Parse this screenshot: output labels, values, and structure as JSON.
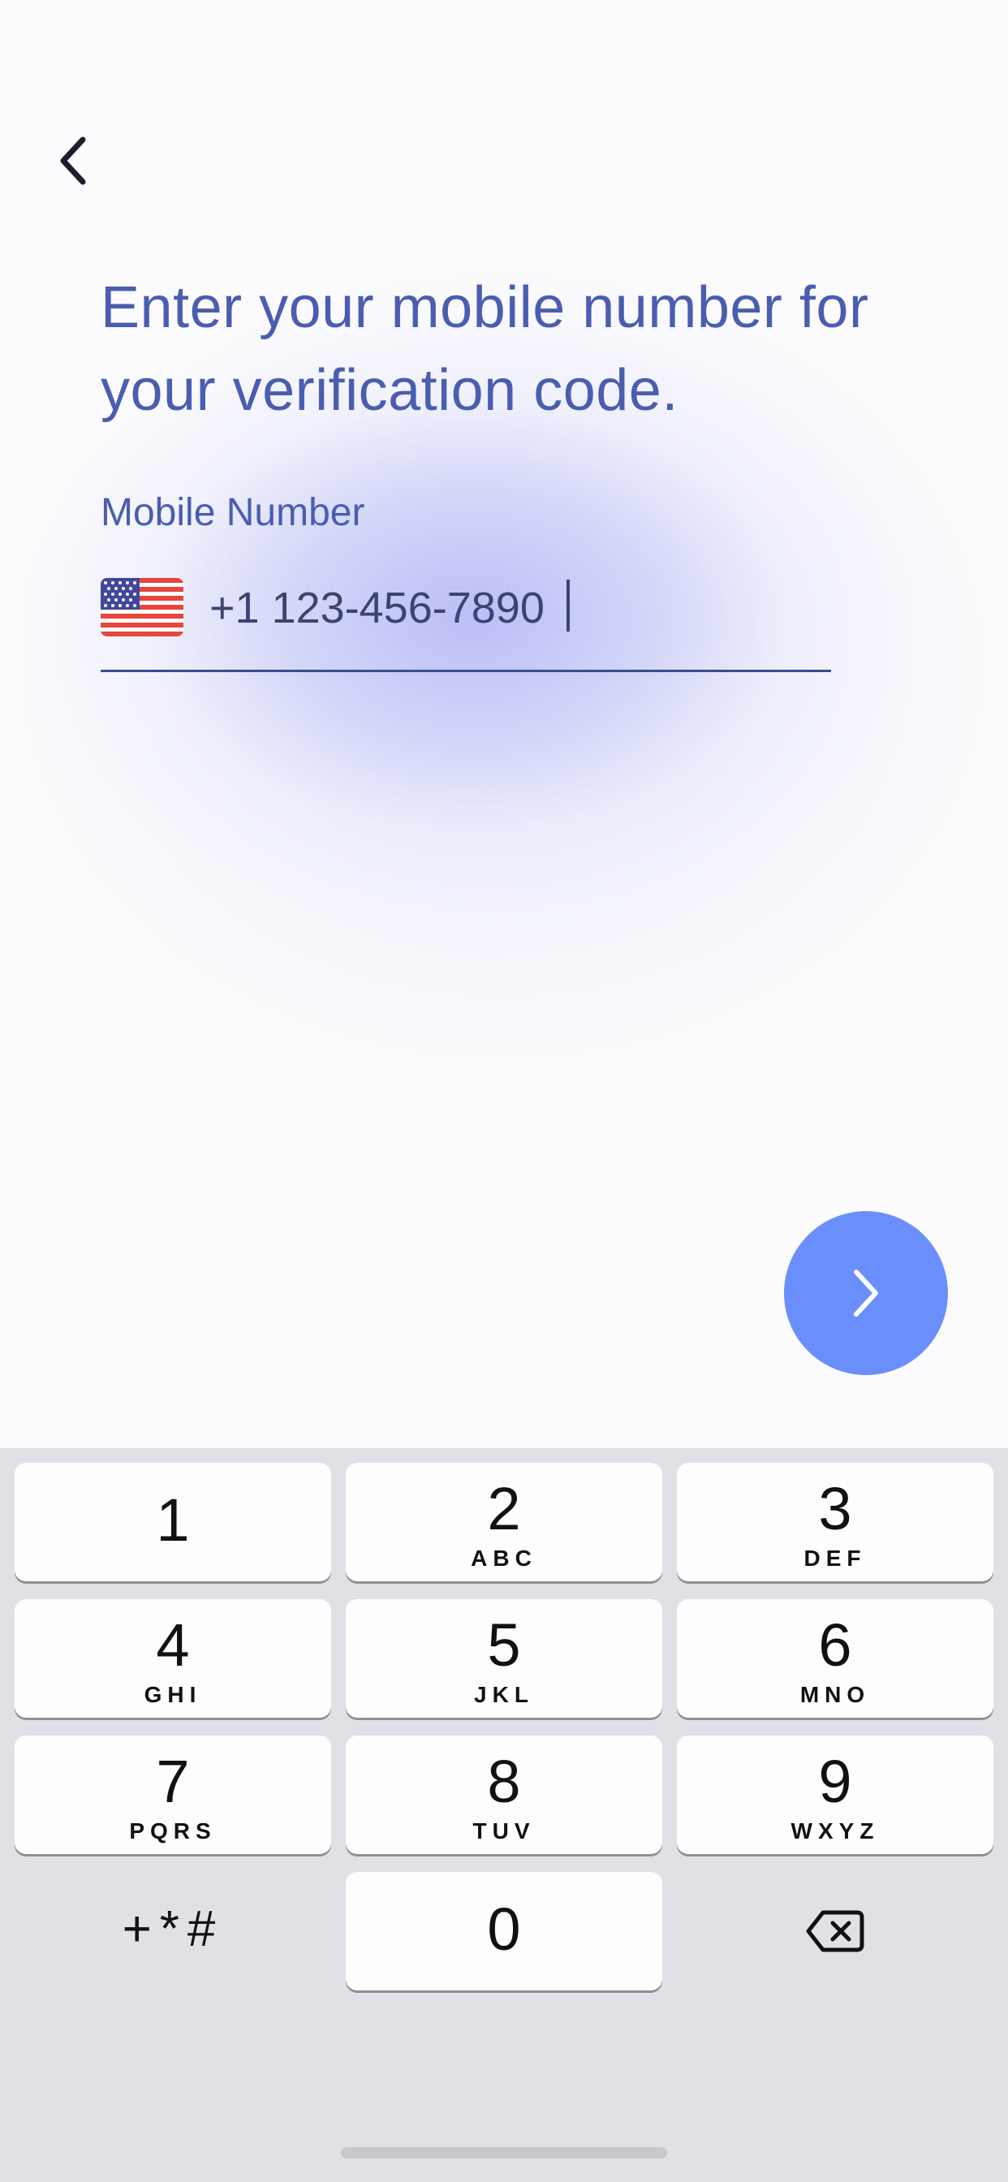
{
  "header": {
    "back_icon": "chevron-left-icon"
  },
  "main": {
    "headline": "Enter your mobile number for your verification code.",
    "field_label": "Mobile Number",
    "country_flag_icon": "us-flag-icon",
    "phone_value": "+1 123-456-7890",
    "next_icon": "chevron-right-icon",
    "accent_color": "#6a8ffc",
    "text_color": "#4a5db0"
  },
  "keyboard": {
    "keys": [
      {
        "digit": "1",
        "letters": ""
      },
      {
        "digit": "2",
        "letters": "ABC"
      },
      {
        "digit": "3",
        "letters": "DEF"
      },
      {
        "digit": "4",
        "letters": "GHI"
      },
      {
        "digit": "5",
        "letters": "JKL"
      },
      {
        "digit": "6",
        "letters": "MNO"
      },
      {
        "digit": "7",
        "letters": "PQRS"
      },
      {
        "digit": "8",
        "letters": "TUV"
      },
      {
        "digit": "9",
        "letters": "WXYZ"
      },
      {
        "digit": "0",
        "letters": ""
      }
    ],
    "symbols_label": "+*#",
    "delete_icon": "backspace-icon"
  }
}
